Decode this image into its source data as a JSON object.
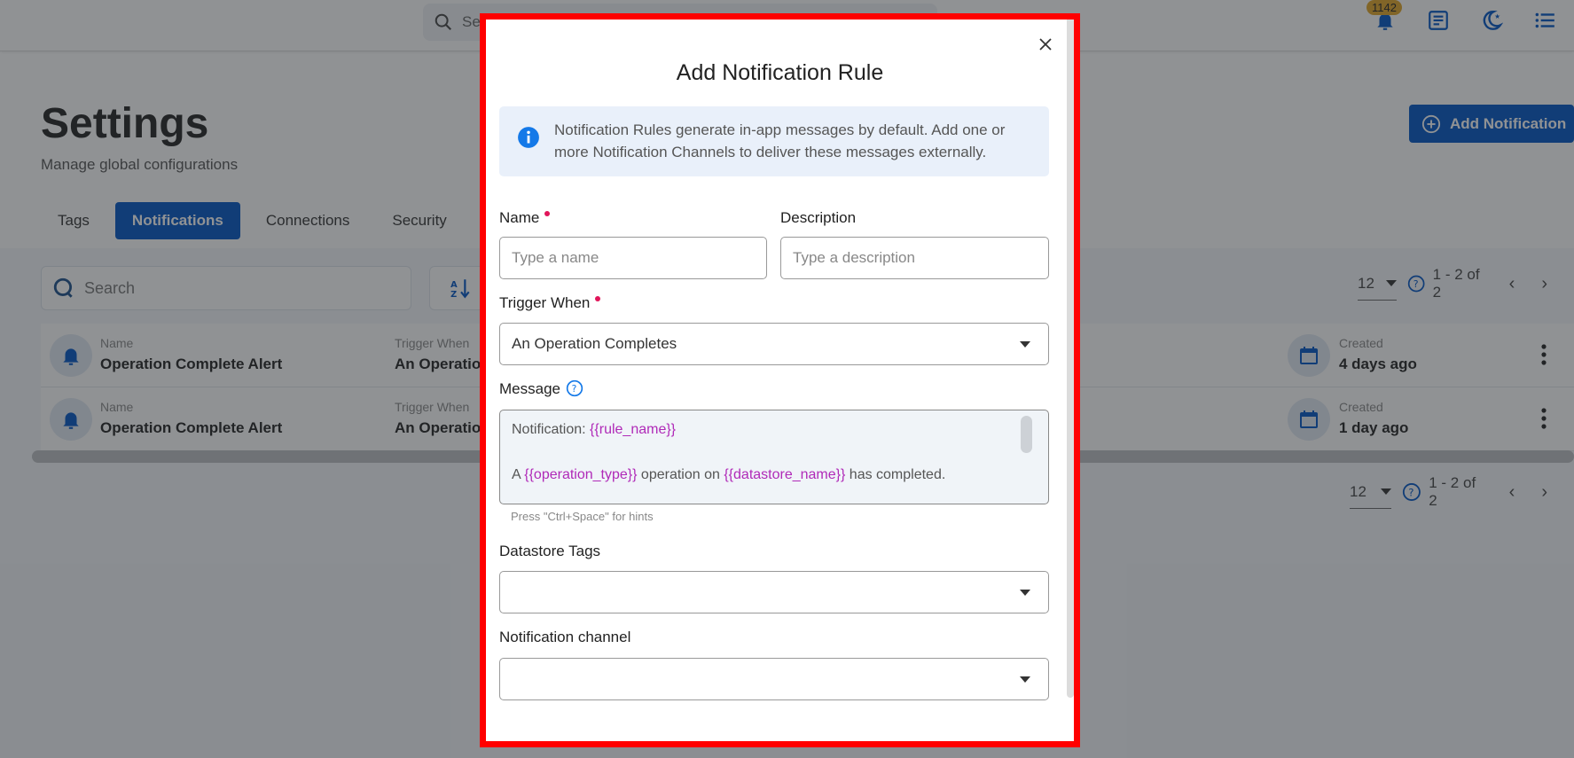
{
  "topbar": {
    "search_placeholder": "Search",
    "notification_count": "1142",
    "icons": [
      "bell-icon",
      "document-icon",
      "dark-mode-icon",
      "menu-list-icon"
    ]
  },
  "page": {
    "title": "Settings",
    "subtitle": "Manage global configurations",
    "add_button_label": "Add Notification",
    "tabs": [
      {
        "label": "Tags",
        "active": false
      },
      {
        "label": "Notifications",
        "active": true
      },
      {
        "label": "Connections",
        "active": false
      },
      {
        "label": "Security",
        "active": false
      }
    ]
  },
  "list": {
    "search_placeholder": "Search",
    "pagination_top": {
      "per_page": "12",
      "range": "1 - 2 of 2"
    },
    "pagination_bottom": {
      "per_page": "12",
      "range": "1 - 2 of 2"
    },
    "rows": [
      {
        "name_label": "Name",
        "name": "Operation Complete Alert",
        "trigger_label": "Trigger When",
        "trigger": "An Operation Completes",
        "created_label": "Created",
        "created": "4 days ago"
      },
      {
        "name_label": "Name",
        "name": "Operation Complete Alert",
        "trigger_label": "Trigger When",
        "trigger": "An Operation Completes",
        "created_label": "Created",
        "created": "1 day ago"
      }
    ]
  },
  "modal": {
    "title": "Add Notification Rule",
    "info_text": "Notification Rules generate in-app messages by default. Add one or more Notification Channels to deliver these messages externally.",
    "name_label": "Name",
    "name_placeholder": "Type a name",
    "name_value": "",
    "description_label": "Description",
    "description_placeholder": "Type a description",
    "description_value": "",
    "trigger_label": "Trigger When",
    "trigger_value": "An Operation Completes",
    "message_label": "Message",
    "message": {
      "line1_prefix": "Notification: ",
      "line1_var": "{{rule_name}}",
      "line2_prefix": "A ",
      "line2_var1": "{{operation_type}}",
      "line2_mid": " operation on ",
      "line2_var2": "{{datastore_name}}",
      "line2_suffix": " has completed."
    },
    "hint": "Press \"Ctrl+Space\" for hints",
    "datastore_tags_label": "Datastore Tags",
    "datastore_tags_value": "",
    "channel_label": "Notification channel",
    "channel_value": ""
  },
  "colors": {
    "primary": "#0055c4",
    "required": "#e1155a",
    "template_var": "#b02ab8",
    "highlight_border": "#ff0000",
    "badge": "#e0a526"
  }
}
